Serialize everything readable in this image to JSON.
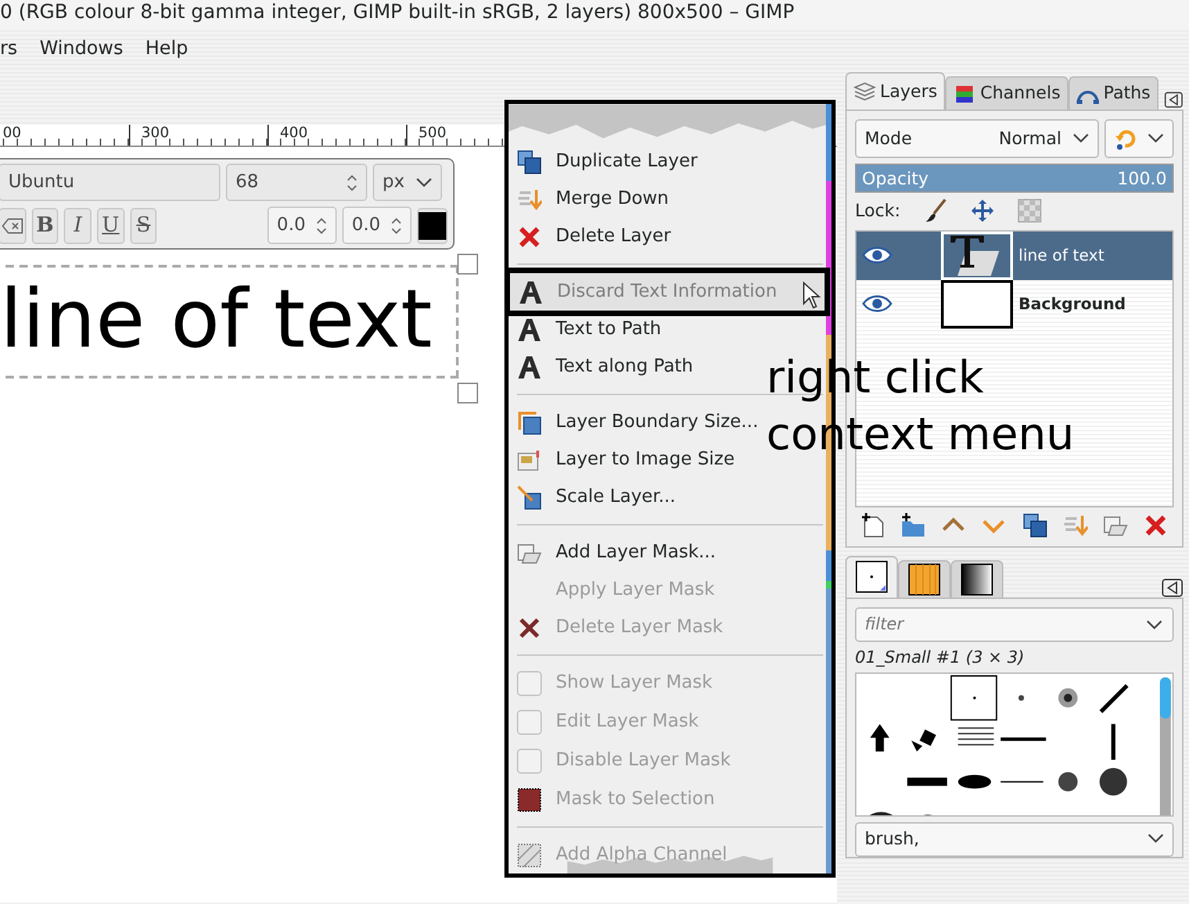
{
  "window": {
    "title": "0 (RGB colour 8-bit gamma integer, GIMP built-in sRGB, 2 layers) 800x500 – GIMP"
  },
  "menubar": [
    {
      "label": "rs"
    },
    {
      "label": "Windows"
    },
    {
      "label": "Help"
    }
  ],
  "ruler": {
    "labels": [
      "00",
      "300",
      "400",
      "500"
    ]
  },
  "text_toolbox": {
    "font": "Ubuntu",
    "size": "68",
    "unit": "px",
    "style_buttons": [
      {
        "label": "B"
      },
      {
        "label": "I"
      },
      {
        "label": "U"
      },
      {
        "label": "S"
      }
    ],
    "baseline": "0.0",
    "kerning": "0.0"
  },
  "canvas": {
    "text": "line of text"
  },
  "context_menu": {
    "items": [
      {
        "kind": "item",
        "label": "Duplicate Layer",
        "disabled": false,
        "selected": false
      },
      {
        "kind": "item",
        "label": "Merge Down",
        "disabled": false,
        "selected": false
      },
      {
        "kind": "item",
        "label": "Delete Layer",
        "disabled": false,
        "selected": false
      },
      {
        "kind": "separator"
      },
      {
        "kind": "item",
        "label": "Discard Text Information",
        "disabled": true,
        "selected": true
      },
      {
        "kind": "item",
        "label": "Text to Path",
        "disabled": false,
        "selected": false
      },
      {
        "kind": "item",
        "label": "Text along Path",
        "disabled": false,
        "selected": false
      },
      {
        "kind": "separator"
      },
      {
        "kind": "item",
        "label": "Layer Boundary Size...",
        "disabled": false,
        "selected": false
      },
      {
        "kind": "item",
        "label": "Layer to Image Size",
        "disabled": false,
        "selected": false
      },
      {
        "kind": "item",
        "label": "Scale Layer...",
        "disabled": false,
        "selected": false
      },
      {
        "kind": "separator"
      },
      {
        "kind": "item",
        "label": "Add Layer Mask...",
        "disabled": false,
        "selected": false
      },
      {
        "kind": "item",
        "label": "Apply Layer Mask",
        "disabled": true,
        "selected": false
      },
      {
        "kind": "item",
        "label": "Delete Layer Mask",
        "disabled": true,
        "selected": false
      },
      {
        "kind": "separator"
      },
      {
        "kind": "check",
        "label": "Show Layer Mask",
        "disabled": true,
        "checked": false,
        "selected": false
      },
      {
        "kind": "check",
        "label": "Edit Layer Mask",
        "disabled": true,
        "checked": false,
        "selected": false
      },
      {
        "kind": "check",
        "label": "Disable Layer Mask",
        "disabled": true,
        "checked": false,
        "selected": false
      },
      {
        "kind": "item",
        "label": "Mask to Selection",
        "disabled": true,
        "selected": false
      },
      {
        "kind": "separator"
      },
      {
        "kind": "item",
        "label": "Add Alpha Channel",
        "disabled": true,
        "selected": false
      }
    ]
  },
  "annotation": {
    "lines": [
      "right click",
      "context menu"
    ]
  },
  "layers_dock": {
    "tabs": [
      {
        "label": "Layers",
        "selected": true
      },
      {
        "label": "Channels",
        "selected": false
      },
      {
        "label": "Paths",
        "selected": false
      }
    ],
    "mode_label": "Mode",
    "mode_value": "Normal",
    "opacity_label": "Opacity",
    "opacity_value": "100.0",
    "opacity": {
      "level": 1.0
    },
    "lock_label": "Lock:",
    "layers": [
      {
        "name": "line of text",
        "selected": true,
        "visible": true,
        "bold": false
      },
      {
        "name": "Background",
        "selected": false,
        "visible": true,
        "bold": true
      }
    ]
  },
  "brushes_dock": {
    "tabs": [
      {
        "selected": true
      },
      {
        "selected": false
      },
      {
        "selected": false
      }
    ],
    "filter_placeholder": "filter",
    "brush_name": "01_Small #1 (3 × 3)",
    "tags_value": "brush,"
  }
}
